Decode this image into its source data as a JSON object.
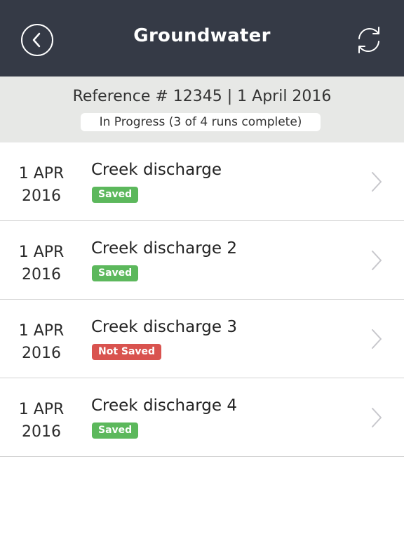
{
  "header": {
    "title": "Groundwater",
    "back_icon": "back-arrow-icon",
    "sync_icon": "refresh-icon",
    "background_color": "#353a46"
  },
  "summary": {
    "reference": "Reference # 12345 | 1 April 2016",
    "status": "In Progress (3 of 4 runs complete)"
  },
  "runs": [
    {
      "date_line1": "1 APR",
      "date_line2": "2016",
      "name": "Creek discharge",
      "status": "Saved",
      "status_color": "#5cb85c"
    },
    {
      "date_line1": "1 APR",
      "date_line2": "2016",
      "name": "Creek discharge 2",
      "status": "Saved",
      "status_color": "#5cb85c"
    },
    {
      "date_line1": "1 APR",
      "date_line2": "2016",
      "name": "Creek discharge 3",
      "status": "Not Saved",
      "status_color": "#d9534f"
    },
    {
      "date_line1": "1 APR",
      "date_line2": "2016",
      "name": "Creek discharge 4",
      "status": "Saved",
      "status_color": "#5cb85c"
    }
  ]
}
